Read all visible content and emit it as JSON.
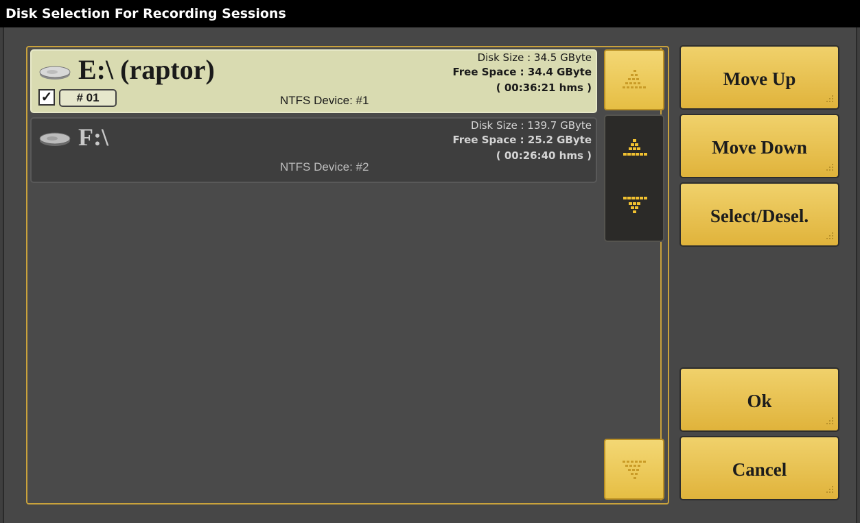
{
  "window": {
    "title": "Disk Selection For Recording Sessions"
  },
  "disks": [
    {
      "name": "E:\\ (raptor)",
      "checked": "✓",
      "number": "# 01",
      "device": "NTFS Device: #1",
      "disk_size": "Disk Size : 34.5 GByte",
      "free_space": "Free Space : 34.4 GByte",
      "duration": "( 00:36:21 hms )",
      "selected": true
    },
    {
      "name": "F:\\",
      "device": "NTFS Device: #2",
      "disk_size": "Disk Size : 139.7 GByte",
      "free_space": "Free Space : 25.2 GByte",
      "duration": "( 00:26:40 hms )",
      "selected": false
    }
  ],
  "buttons": {
    "move_up": "Move Up",
    "move_down": "Move Down",
    "select_deselect": "Select/Desel.",
    "ok": "Ok",
    "cancel": "Cancel"
  },
  "icons": {
    "drive": "hard-drive-icon",
    "scroll_top": "arrow-up-dotted-icon",
    "scroll_up": "arrow-up-dotted-icon",
    "scroll_down": "arrow-down-dotted-icon",
    "scroll_bottom": "arrow-down-dotted-icon"
  },
  "colors": {
    "accent": "#e8c04d",
    "selected_row": "#d9dbb1",
    "background": "#474747"
  }
}
